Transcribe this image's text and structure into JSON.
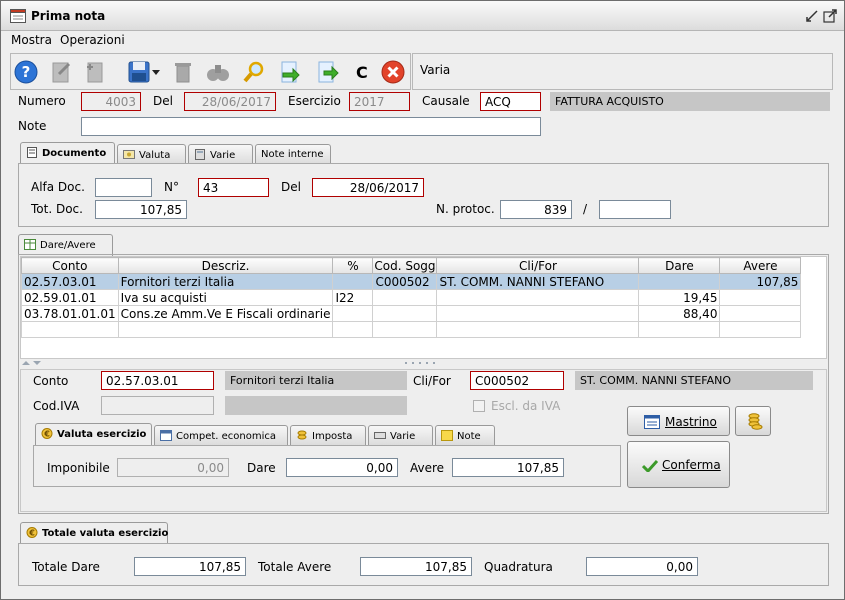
{
  "window": {
    "title": "Prima nota"
  },
  "menu": {
    "items": [
      "Mostra",
      "Operazioni"
    ]
  },
  "toolbar": {
    "varia_label": "Varia",
    "c_label": "C"
  },
  "header": {
    "numero_label": "Numero",
    "numero": "4003",
    "del_label": "Del",
    "del": "28/06/2017",
    "esercizio_label": "Esercizio",
    "esercizio": "2017",
    "causale_label": "Causale",
    "causale": "ACQ",
    "causale_desc": "FATTURA ACQUISTO",
    "note_label": "Note",
    "note": ""
  },
  "doc_tabs": [
    "Documento",
    "Valuta",
    "Varie",
    "Note interne"
  ],
  "documento": {
    "alfa_label": "Alfa Doc.",
    "alfa": "",
    "n_label": "N°",
    "n": "43",
    "del_label": "Del",
    "del": "28/06/2017",
    "tot_label": "Tot. Doc.",
    "tot": "107,85",
    "protoc_label": "N. protoc.",
    "protoc": "839",
    "slash": "/",
    "protoc2": ""
  },
  "dare_avere_tab": "Dare/Avere",
  "grid": {
    "columns": [
      "Conto",
      "Descriz.",
      "%",
      "Cod. Sogg",
      "Cli/For",
      "Dare",
      "Avere"
    ],
    "rows": [
      [
        "02.57.03.01",
        "Fornitori terzi Italia",
        "",
        "C000502",
        "ST. COMM. NANNI STEFANO",
        "",
        "107,85"
      ],
      [
        "02.59.01.01",
        "Iva su acquisti",
        "I22",
        "",
        "",
        "19,45",
        ""
      ],
      [
        "03.78.01.01.01",
        "Cons.ze Amm.Ve E Fiscali ordinarie",
        "",
        "",
        "",
        "88,40",
        ""
      ],
      [
        "",
        "",
        "",
        "",
        "",
        "",
        ""
      ]
    ]
  },
  "detail": {
    "conto_label": "Conto",
    "conto": "02.57.03.01",
    "conto_desc": "Fornitori terzi Italia",
    "clifor_label": "Cli/For",
    "clifor": "C000502",
    "clifor_desc": "ST. COMM. NANNI STEFANO",
    "codiva_label": "Cod.IVA",
    "codiva": "",
    "codiva_desc": "",
    "escl_label": "Escl. da IVA",
    "mastrino_label": "Mastrino",
    "conferma_label": "Conferma"
  },
  "detail_tabs": [
    "Valuta esercizio",
    "Compet. economica",
    "Imposta",
    "Varie",
    "Note"
  ],
  "valuta": {
    "imponibile_label": "Imponibile",
    "imponibile": "0,00",
    "dare_label": "Dare",
    "dare": "0,00",
    "avere_label": "Avere",
    "avere": "107,85"
  },
  "totali_tab": "Totale valuta esercizio",
  "totali": {
    "dare_label": "Totale Dare",
    "dare": "107,85",
    "avere_label": "Totale Avere",
    "avere": "107,85",
    "quad_label": "Quadratura",
    "quad": "0,00"
  },
  "colors": {
    "selected_row": "#b8cfe5",
    "error_border": "#b00000",
    "readonly_fill": "#c6c6c6"
  }
}
